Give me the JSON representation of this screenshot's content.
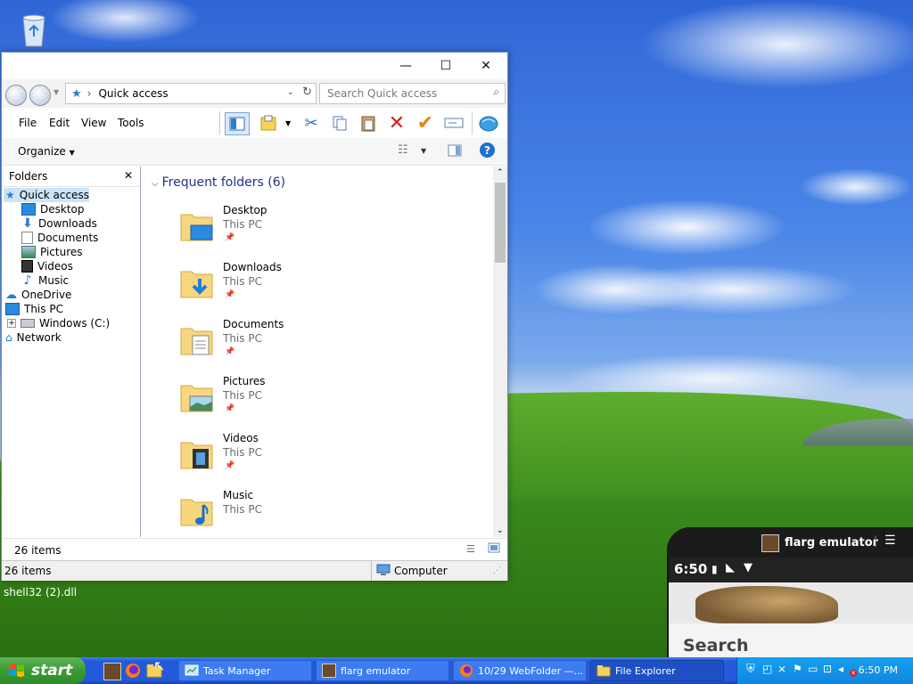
{
  "window": {
    "address_label": "Quick access",
    "search_placeholder": "Search Quick access",
    "menus": [
      "File",
      "Edit",
      "View",
      "Tools"
    ],
    "organize_label": "Organize",
    "folders_pane_title": "Folders",
    "tree": [
      {
        "label": "Quick access",
        "icon": "star-icon",
        "selected": true
      },
      {
        "label": "Desktop",
        "icon": "desktop-icon"
      },
      {
        "label": "Downloads",
        "icon": "download-icon"
      },
      {
        "label": "Documents",
        "icon": "documents-icon"
      },
      {
        "label": "Pictures",
        "icon": "pictures-icon"
      },
      {
        "label": "Videos",
        "icon": "videos-icon"
      },
      {
        "label": "Music",
        "icon": "music-icon"
      },
      {
        "label": "OneDrive",
        "icon": "cloud-icon"
      },
      {
        "label": "This PC",
        "icon": "computer-icon"
      },
      {
        "label": "Windows (C:)",
        "icon": "drive-icon"
      },
      {
        "label": "Network",
        "icon": "network-icon"
      }
    ],
    "section_title": "Frequent folders (6)",
    "folders": [
      {
        "name": "Desktop",
        "location": "This PC",
        "icon": "desktop-folder-icon"
      },
      {
        "name": "Downloads",
        "location": "This PC",
        "icon": "downloads-folder-icon"
      },
      {
        "name": "Documents",
        "location": "This PC",
        "icon": "documents-folder-icon"
      },
      {
        "name": "Pictures",
        "location": "This PC",
        "icon": "pictures-folder-icon"
      },
      {
        "name": "Videos",
        "location": "This PC",
        "icon": "videos-folder-icon"
      },
      {
        "name": "Music",
        "location": "This PC",
        "icon": "music-folder-icon"
      }
    ],
    "status_items": "26 items",
    "status_items2": "26 items",
    "status_location": "Computer"
  },
  "desktop": {
    "tooltip": "shell32 (2).dll"
  },
  "phone": {
    "app_title": "flarg emulator",
    "time": "6:50",
    "search_label": "Search"
  },
  "taskbar": {
    "start_label": "start",
    "tasks": [
      {
        "label": "Task Manager"
      },
      {
        "label": "flarg emulator"
      },
      {
        "label": "10/29 WebFolder —..."
      },
      {
        "label": "File Explorer"
      }
    ],
    "clock": "6:50 PM"
  },
  "colors": {
    "accent": "#1e3287",
    "taskbar": "#245ad9",
    "start": "#3a9b35",
    "tray": "#0f86e0"
  }
}
